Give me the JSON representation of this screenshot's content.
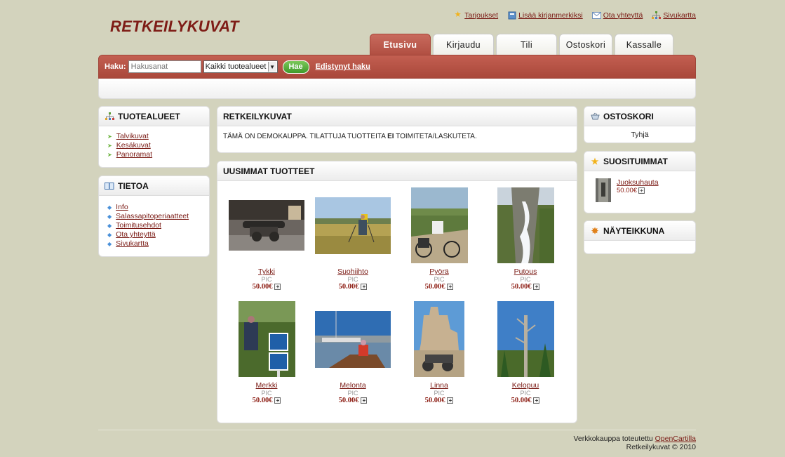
{
  "header": {
    "logo_part1": "Retkeily",
    "logo_part2": "kuvat",
    "links": {
      "offers": "Tarjoukset",
      "bookmark": "Lisää kirjanmerkiksi",
      "contact": "Ota yhteyttä",
      "sitemap": "Sivukartta"
    }
  },
  "tabs": {
    "home": "Etusivu",
    "login": "Kirjaudu",
    "account": "Tili",
    "cart": "Ostoskori",
    "checkout": "Kassalle"
  },
  "search": {
    "label": "Haku:",
    "placeholder": "Hakusanat",
    "category_selected": "Kaikki tuotealueet",
    "button": "Hae",
    "advanced": "Edistynyt haku"
  },
  "categories": {
    "title": "TUOTEALUEET",
    "items": [
      "Talvikuvat",
      "Kesäkuvat",
      "Panoramat"
    ]
  },
  "info": {
    "title": "TIETOA",
    "items": [
      "Info",
      "Salassapitoperiaatteet",
      "Toimitusehdot",
      "Ota yhteyttä",
      "Sivukartta"
    ]
  },
  "welcome": {
    "title": "RETKEILYKUVAT",
    "text_before": "TÄMÄ ON DEMOKAUPPA. TILATTUJA TUOTTEITA ",
    "text_bold": "EI",
    "text_after": " TOIMITETA/LASKUTETA."
  },
  "latest": {
    "title": "UUSIMMAT TUOTTEET",
    "products": [
      {
        "name": "Tykki",
        "model": "PIC",
        "price": "50.00€"
      },
      {
        "name": "Suohiihto",
        "model": "PIC",
        "price": "50.00€"
      },
      {
        "name": "Pyörä",
        "model": "PIC",
        "price": "50.00€"
      },
      {
        "name": "Putous",
        "model": "PIC",
        "price": "50.00€"
      },
      {
        "name": "Merkki",
        "model": "PIC",
        "price": "50.00€"
      },
      {
        "name": "Melonta",
        "model": "PIC",
        "price": "50.00€"
      },
      {
        "name": "Linna",
        "model": "PIC",
        "price": "50.00€"
      },
      {
        "name": "Kelopuu",
        "model": "PIC",
        "price": "50.00€"
      }
    ]
  },
  "cart": {
    "title": "OSTOSKORI",
    "status": "Tyhjä"
  },
  "bestsellers": {
    "title": "SUOSITUIMMAT",
    "item_name": "Juoksuhauta",
    "item_price": "50.00€"
  },
  "showcase": {
    "title": "NÄYTEIKKUNA"
  },
  "footer": {
    "powered_text": "Verkkokauppa toteutettu ",
    "powered_link": "OpenCartilla",
    "copyright": "Retkeilykuvat © 2010"
  }
}
